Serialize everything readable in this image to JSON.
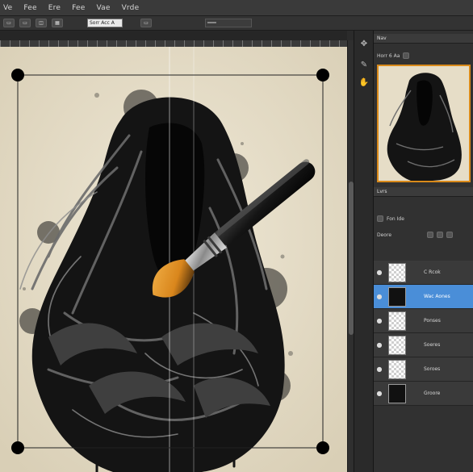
{
  "menubar": {
    "items": [
      "Ve",
      "Fee",
      "Ere",
      "Fee",
      "Vae",
      "Vrde"
    ]
  },
  "optionsbar": {
    "buttons": [
      "▭",
      "▭",
      "◫",
      "▦"
    ],
    "field_1": "Sorr Acc A",
    "field_2": "▭",
    "field_3": "═══"
  },
  "navigator": {
    "title": "Nav",
    "zoom": "Horr 6 Aa"
  },
  "layers_panel": {
    "title": "Lvrs",
    "row_1": "Fon Ide",
    "row_2": "Deore",
    "layers": [
      {
        "name": "C Rcok",
        "thumb": "checker",
        "selected": false
      },
      {
        "name": "Wac Aones",
        "thumb": "dark",
        "selected": true
      },
      {
        "name": "Ponses",
        "thumb": "checker",
        "selected": false
      },
      {
        "name": "Soeres",
        "thumb": "checker",
        "selected": false
      },
      {
        "name": "Soroes",
        "thumb": "checker",
        "selected": false
      },
      {
        "name": "Groore",
        "thumb": "dark",
        "selected": false
      }
    ]
  },
  "icons": {
    "tools": [
      "move-icon",
      "brush-icon",
      "hand-icon"
    ],
    "eye": "eye-icon"
  },
  "colors": {
    "accent": "#4a8ed8",
    "highlight": "#d98a1a",
    "canvas": "#e8e1cf",
    "ink": "#141414",
    "bristle": "#e39a2a"
  }
}
